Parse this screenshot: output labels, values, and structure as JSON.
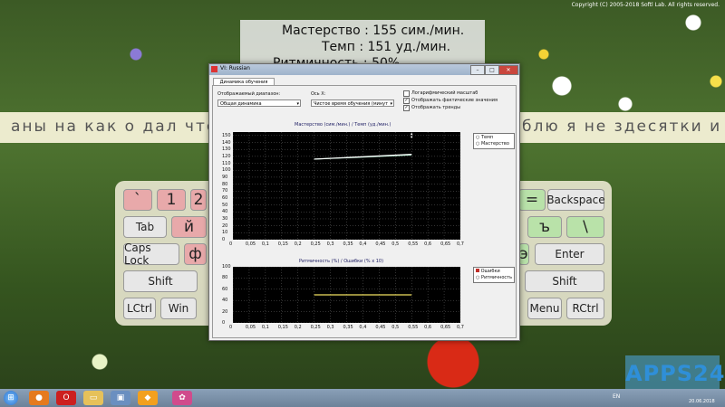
{
  "copyright": "Copyright (C) 2005-2018 Softl Lab. All rights reserved.",
  "stats": {
    "mastery": "Мастерство : 155 сим./мин.",
    "tempo": "Темп : 151 уд./мин.",
    "rhythm": "Ритмичность : 50%"
  },
  "practice_text": "аны на как о дал что",
  "practice_text_right": "блю я не здесятки и",
  "keyboard": {
    "rows": [
      [
        "`",
        "1",
        "2"
      ],
      [
        "Tab",
        "й"
      ],
      [
        "Caps Lock",
        "ф"
      ],
      [
        "Shift"
      ],
      [
        "LCtrl",
        "Win"
      ]
    ],
    "right_keys": [
      "=",
      "Backspace",
      "ъ",
      "\\",
      "э",
      "Enter",
      "Shift",
      "Menu",
      "RCtrl"
    ]
  },
  "window": {
    "title": "VI: Russian",
    "tab": "Динамика обучения",
    "range_label": "Отображаемый диапазон:",
    "range_value": "Общая динамика",
    "axis_label": "Ось X:",
    "axis_value": "Чистое время обучения (минут",
    "options": [
      "Логарифмический масштаб",
      "Отображать фактические значения",
      "Отображать тренды"
    ],
    "options_checked": [
      false,
      true,
      true
    ]
  },
  "chart_data": [
    {
      "type": "line",
      "title": "Мастерство (сим./мин.) / Темп (уд./мин.)",
      "x_ticks": [
        "0",
        "0,05",
        "0,1",
        "0,15",
        "0,2",
        "0,25",
        "0,3",
        "0,35",
        "0,4",
        "0,45",
        "0,5",
        "0,55",
        "0,6",
        "0,65",
        "0,7"
      ],
      "y_ticks": [
        "0",
        "10",
        "20",
        "30",
        "40",
        "50",
        "60",
        "70",
        "80",
        "90",
        "100",
        "110",
        "120",
        "130",
        "140",
        "150"
      ],
      "xlim": [
        0,
        0.7
      ],
      "ylim": [
        0,
        155
      ],
      "series": [
        {
          "name": "Темп",
          "x": [
            0.25,
            0.55
          ],
          "y": [
            116,
            122
          ],
          "color": "#a8e8c8"
        },
        {
          "name": "Мастерство",
          "x": [
            0.25,
            0.55
          ],
          "y": [
            116,
            123
          ],
          "color": "#ffffff"
        }
      ],
      "points": [
        {
          "x": 0.55,
          "y": 152
        },
        {
          "x": 0.55,
          "y": 148
        }
      ],
      "legend": "top-right",
      "grid": true
    },
    {
      "type": "line",
      "title": "Ритмичность (%) / Ошибки (% x 10)",
      "x_ticks": [
        "0",
        "0,05",
        "0,1",
        "0,15",
        "0,2",
        "0,25",
        "0,3",
        "0,35",
        "0,4",
        "0,45",
        "0,5",
        "0,55",
        "0,6",
        "0,65",
        "0,7"
      ],
      "y_ticks": [
        "0",
        "20",
        "40",
        "60",
        "80",
        "100"
      ],
      "xlim": [
        0,
        0.7
      ],
      "ylim": [
        0,
        100
      ],
      "series": [
        {
          "name": "Ошибки",
          "x": [
            0.25,
            0.55
          ],
          "y": [
            0,
            0
          ],
          "color": "#c0302a"
        },
        {
          "name": "Ритмичность",
          "x": [
            0.25,
            0.55
          ],
          "y": [
            50,
            50
          ],
          "color": "#f0e060"
        }
      ],
      "legend": "top-right",
      "grid": true
    }
  ],
  "taskbar": {
    "start": "⊞",
    "lang": "EN",
    "date": "20.06.2018"
  },
  "watermark": "APPS24",
  "colors": {
    "key_pink": "#e8a9aa",
    "key_green": "#b9e2a9",
    "window_bg": "#f0f0f0",
    "plot_bg": "#000000"
  }
}
